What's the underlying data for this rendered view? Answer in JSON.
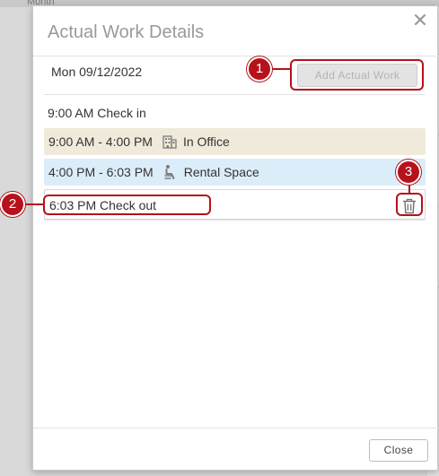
{
  "background": {
    "topbar_label": "Month"
  },
  "dialog": {
    "title": "Actual Work Details",
    "close_icon": "close-x-icon",
    "date": "Mon 09/12/2022",
    "add_button_label": "Add Actual Work",
    "check_in": "9:00 AM Check in",
    "entries": [
      {
        "time": "9:00 AM - 4:00 PM",
        "location": "In Office",
        "icon": "building-icon",
        "color": "#f0eadb"
      },
      {
        "time": "4:00 PM - 6:03 PM",
        "location": "Rental Space",
        "icon": "seat-icon",
        "color": "#dcedfa"
      }
    ],
    "check_out": "6:03 PM Check out",
    "delete_icon": "trash-icon",
    "close_button_label": "Close"
  },
  "annotations": {
    "color": "#b5121b",
    "callouts": [
      "1",
      "2",
      "3"
    ]
  }
}
